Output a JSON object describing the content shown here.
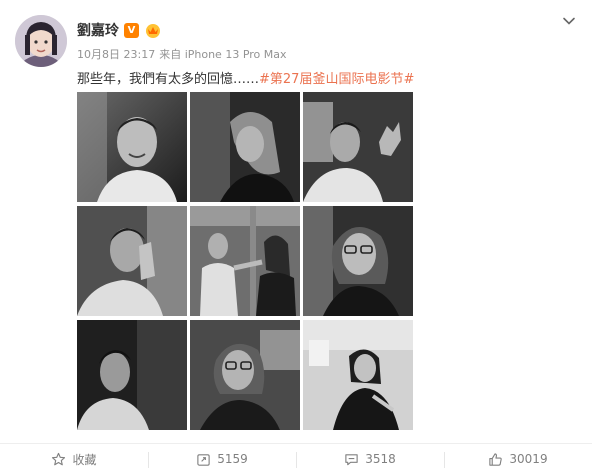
{
  "author": {
    "name": "劉嘉玲",
    "verified_badge": "V",
    "badge_color": "#ff8200"
  },
  "meta": {
    "time": "10月8日 23:17",
    "source": "来自 iPhone 13 Pro Max"
  },
  "post": {
    "text": "那些年，我們有太多的回憶……",
    "hashtag": "#第27届釜山国际电影节#",
    "hashtag_color": "#eb7350"
  },
  "photos": [
    {
      "icon": "photo-smiling-man"
    },
    {
      "icon": "photo-long-hair-profile"
    },
    {
      "icon": "photo-man-gesturing"
    },
    {
      "icon": "photo-man-hand-on-face"
    },
    {
      "icon": "photo-two-people-talking"
    },
    {
      "icon": "photo-woman-glasses"
    },
    {
      "icon": "photo-man-profile"
    },
    {
      "icon": "photo-woman-glasses-talking"
    },
    {
      "icon": "photo-woman-seated"
    }
  ],
  "actions": {
    "favorite": "收藏",
    "repost": "5159",
    "comment": "3518",
    "like": "30019"
  }
}
